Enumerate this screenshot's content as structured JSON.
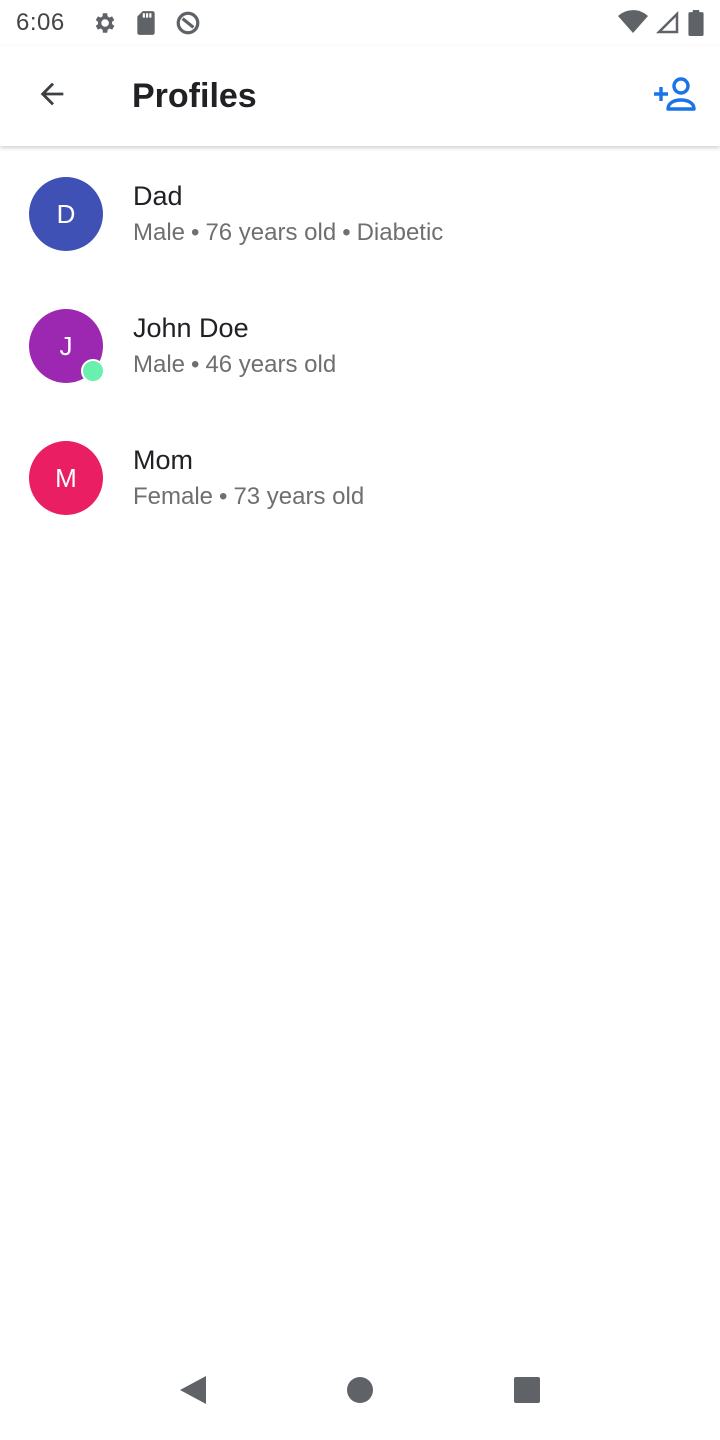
{
  "status_bar": {
    "time": "6:06",
    "icons_left": [
      "settings-icon",
      "sd-card-icon",
      "data-saver-icon"
    ],
    "icons_right": [
      "wifi-icon",
      "cell-signal-icon",
      "battery-icon"
    ]
  },
  "app_bar": {
    "title": "Profiles",
    "back_icon": "arrow-back-icon",
    "action_icon": "person-add-icon"
  },
  "colors": {
    "accent": "#1a73e8",
    "online": "#69f0ae"
  },
  "profiles": [
    {
      "initial": "D",
      "name": "Dad",
      "gender": "Male",
      "age": "76 years old",
      "condition": "Diabetic",
      "avatar_color": "#3f51b5",
      "online": false
    },
    {
      "initial": "J",
      "name": "John Doe",
      "gender": "Male",
      "age": "46 years old",
      "avatar_color": "#9c27b0",
      "online": true
    },
    {
      "initial": "M",
      "name": "Mom",
      "gender": "Female",
      "age": "73 years old",
      "avatar_color": "#e91e63",
      "online": false
    }
  ],
  "nav_bar": {
    "icons": [
      "back-triangle-icon",
      "home-circle-icon",
      "recents-square-icon"
    ]
  }
}
